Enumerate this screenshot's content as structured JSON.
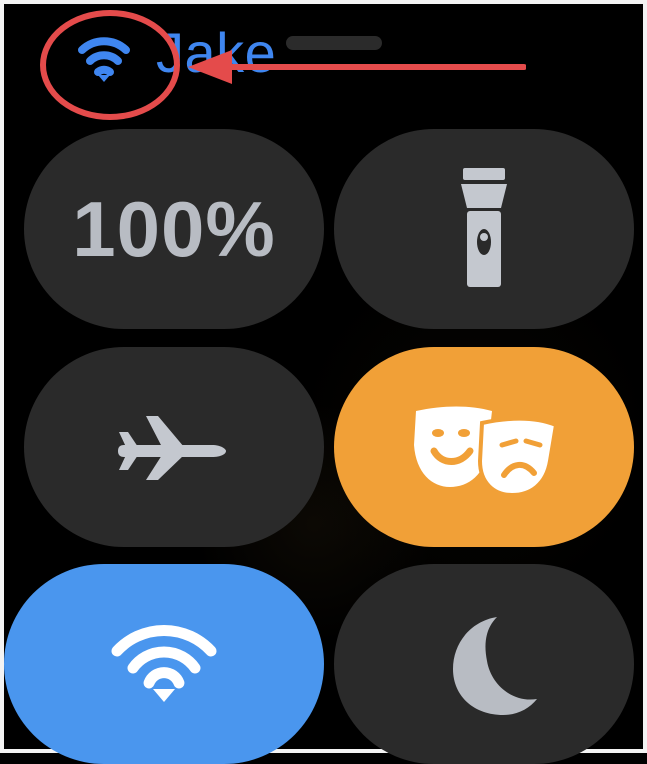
{
  "header": {
    "name": "Jake",
    "icons": [
      "wifi-icon"
    ]
  },
  "controls": {
    "battery_percent": "100%",
    "flashlight": {
      "icon": "flashlight-icon"
    },
    "airplane_mode": {
      "icon": "airplane-icon"
    },
    "theater_mode": {
      "icon": "theater-mask-icon",
      "color": "#f1a037"
    },
    "wifi": {
      "icon": "wifi-icon",
      "color": "#4a96ee"
    },
    "do_not_disturb": {
      "icon": "moon-icon"
    }
  },
  "colors": {
    "accent_blue": "#3f86f0",
    "annotation_red": "#e44b4b",
    "tile_gray": "#2a2a2a"
  }
}
